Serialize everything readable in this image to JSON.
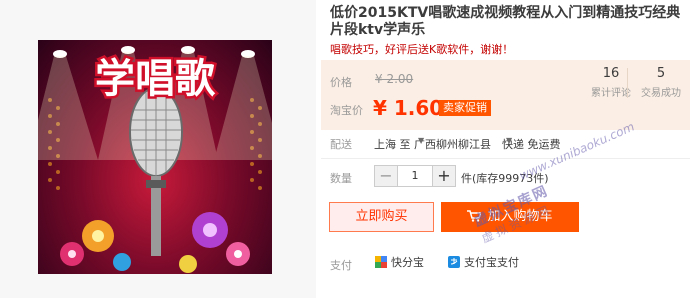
{
  "product": {
    "title": "低价2015KTV唱歌速成视频教程从入门到精通技巧经典片段ktv学声乐",
    "subtitle": "唱歌技巧，好评后送K歌软件，谢谢！",
    "image_text": "学唱歌"
  },
  "price": {
    "label": "价格",
    "original": "¥ 2.00",
    "promo_label": "淘宝价",
    "promo": "¥ 1.60",
    "promo_tag": "卖家促销"
  },
  "stats": [
    {
      "value": "16",
      "label": "累计评论"
    },
    {
      "value": "5",
      "label": "交易成功"
    }
  ],
  "shipping": {
    "label": "配送",
    "from": "上海 至",
    "to": "广西柳州柳江县",
    "method": "快递 免运费"
  },
  "quantity": {
    "label": "数量",
    "value": "1",
    "minus": "−",
    "plus": "+",
    "stock": "件(库存99973件)"
  },
  "actions": {
    "buy_now": "立即购买",
    "add_to_cart": "加入购物车"
  },
  "payment": {
    "label": "支付",
    "methods": [
      "快分宝",
      "支付宝支付"
    ]
  },
  "watermark": {
    "logo": "虚拟宝库网",
    "url": "www.xunibaoku.com",
    "sub": "虚拟资源网"
  },
  "colors": {
    "accent": "#ff5500",
    "price": "#ff3300",
    "panel": "#fbeee4"
  }
}
